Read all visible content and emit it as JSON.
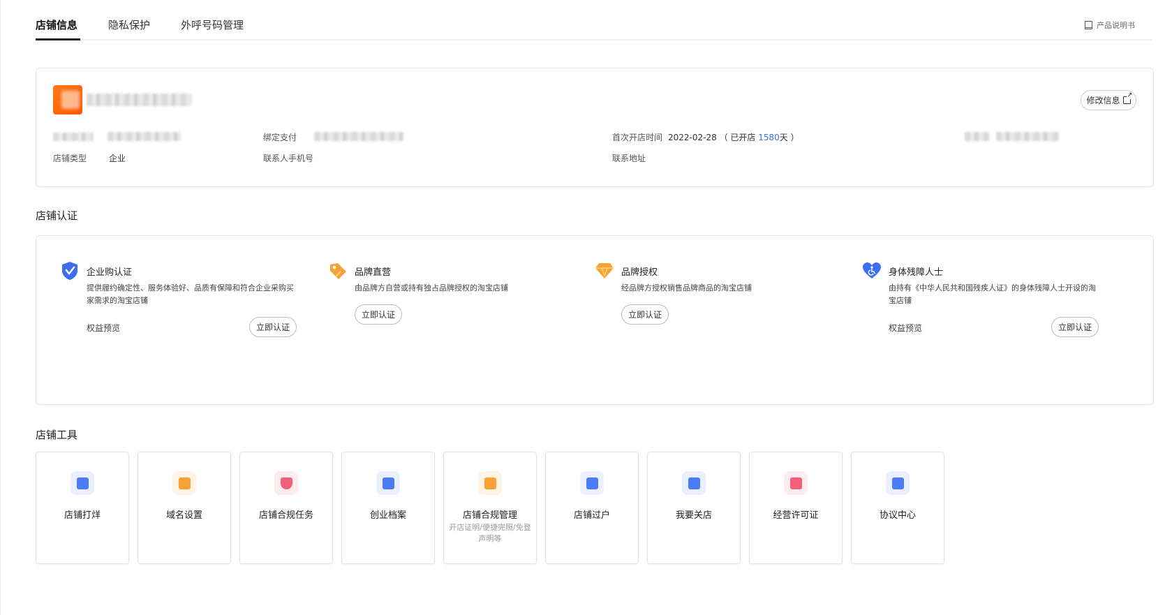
{
  "tabs": [
    {
      "label": "店铺信息",
      "active": true
    },
    {
      "label": "隐私保护",
      "active": false
    },
    {
      "label": "外呼号码管理",
      "active": false
    }
  ],
  "manual_link": "产品说明书",
  "shop_info": {
    "edit_button": "修改信息",
    "bound_pay_label": "绑定支付",
    "open_time_label": "首次开店时间",
    "open_time_value": "2022-02-28",
    "open_days_prefix": "（ 已开店 ",
    "open_days": "1580",
    "open_days_suffix": "天 ）",
    "shop_type_label": "店铺类型",
    "shop_type_value": "企业",
    "contact_phone_label": "联系人手机号",
    "address_label": "联系地址"
  },
  "cert_section": {
    "title": "店铺认证",
    "items": [
      {
        "icon": "shield-check-icon",
        "color": "#3d6df2",
        "title": "企业购认证",
        "desc": "提供履约确定性、服务体验好、品质有保障和符合企业采购买家需求的淘宝店铺",
        "perk_label": "权益预览",
        "button": "立即认证"
      },
      {
        "icon": "tag-icon",
        "color": "#f7a233",
        "title": "品牌直营",
        "desc": "由品牌方自营或持有独占品牌授权的淘宝店铺",
        "button": "立即认证"
      },
      {
        "icon": "diamond-icon",
        "color": "#f7a233",
        "title": "品牌授权",
        "desc": "经品牌方授权销售品牌商品的淘宝店铺",
        "button": "立即认证"
      },
      {
        "icon": "heart-accessibility-icon",
        "color": "#3d6df2",
        "title": "身体残障人士",
        "desc": "由持有《中华人民共和国残疾人证》的身体残障人士开设的淘宝店铺",
        "perk_label": "权益预览",
        "button": "立即认证"
      }
    ]
  },
  "tools_section": {
    "title": "店铺工具",
    "items": [
      {
        "label": "店铺打烊",
        "icon": "shop-close-icon",
        "bg": "#eaf0ff",
        "color": "#4a7cf6"
      },
      {
        "label": "域名设置",
        "icon": "domain-icon",
        "bg": "#fff3e4",
        "color": "#f7a233"
      },
      {
        "label": "店铺合规任务",
        "icon": "shield-search-icon",
        "bg": "#ffecef",
        "color": "#f0607a"
      },
      {
        "label": "创业档案",
        "icon": "archive-icon",
        "bg": "#eaf0ff",
        "color": "#4a7cf6"
      },
      {
        "label": "店铺合规管理",
        "icon": "compliance-doc-icon",
        "bg": "#fff3e4",
        "color": "#f7a233",
        "sub": "开店证明/便捷完照/免登声明等"
      },
      {
        "label": "店铺过户",
        "icon": "transfer-icon",
        "bg": "#eaf0ff",
        "color": "#4a7cf6"
      },
      {
        "label": "我要关店",
        "icon": "close-shop-icon",
        "bg": "#eaf0ff",
        "color": "#4a7cf6"
      },
      {
        "label": "经营许可证",
        "icon": "license-icon",
        "bg": "#ffecef",
        "color": "#f0607a"
      },
      {
        "label": "协议中心",
        "icon": "agreement-icon",
        "bg": "#eaf0ff",
        "color": "#4a7cf6"
      }
    ]
  }
}
